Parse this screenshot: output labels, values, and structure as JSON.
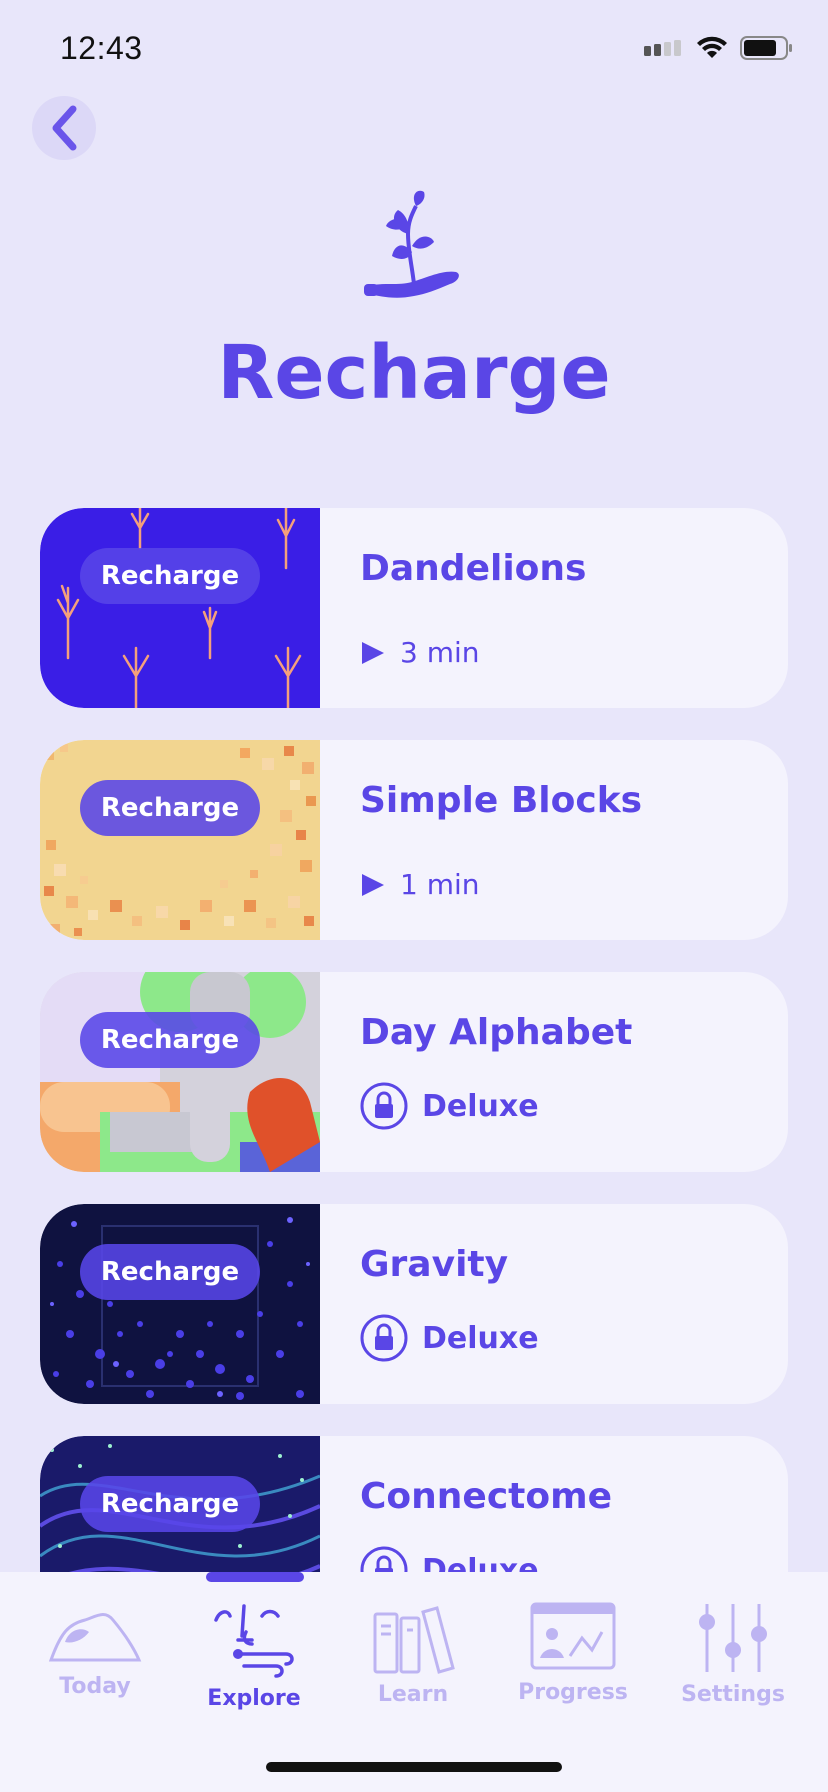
{
  "status_bar": {
    "time": "12:43"
  },
  "header": {
    "title": "Recharge"
  },
  "colors": {
    "accent": "#5a46e6",
    "background": "#e8e6fa",
    "card": "#f4f3fd",
    "inactive_tab": "#bdb4f2"
  },
  "cards": [
    {
      "thumb_label": "Recharge",
      "title": "Dandelions",
      "meta_icon": "play-icon",
      "meta": "3 min"
    },
    {
      "thumb_label": "Recharge",
      "title": "Simple Blocks",
      "meta_icon": "play-icon",
      "meta": "1 min"
    },
    {
      "thumb_label": "Recharge",
      "title": "Day Alphabet",
      "meta_icon": "lock-icon",
      "meta": "Deluxe"
    },
    {
      "thumb_label": "Recharge",
      "title": "Gravity",
      "meta_icon": "lock-icon",
      "meta": "Deluxe"
    },
    {
      "thumb_label": "Recharge",
      "title": "Connectome",
      "meta_icon": "lock-icon",
      "meta": "Deluxe"
    }
  ],
  "tabs": [
    {
      "label": "Today",
      "icon": "mountain-icon",
      "active": false
    },
    {
      "label": "Explore",
      "icon": "explore-icon",
      "active": true
    },
    {
      "label": "Learn",
      "icon": "books-icon",
      "active": false
    },
    {
      "label": "Progress",
      "icon": "progress-icon",
      "active": false
    },
    {
      "label": "Settings",
      "icon": "sliders-icon",
      "active": false
    }
  ]
}
